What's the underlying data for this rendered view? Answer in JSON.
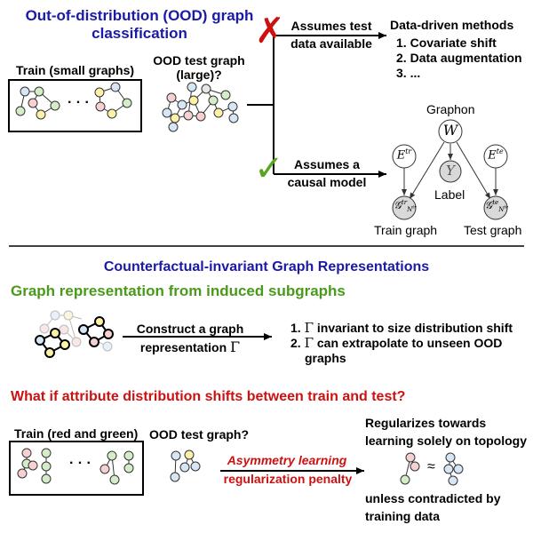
{
  "colors": {
    "title_blue": "#1a1aa6",
    "green": "#4a9a1a",
    "red": "#cc1111",
    "node_blue": "#d6e6f5",
    "node_green": "#d4edc8",
    "node_yellow": "#fdf1a8",
    "node_pink": "#f7d1d1",
    "node_gray": "#e6e6e6"
  },
  "section1": {
    "title_line1": "Out-of-distribution (OOD) graph",
    "title_line2": "classification",
    "train_label": "Train (small graphs)",
    "ellipsis": "· · ·",
    "ood_label_line1": "OOD test graph",
    "ood_label_line2": "(large)?",
    "branch_top_line1": "Assumes test",
    "branch_top_line2": "data available",
    "cross_icon": "✗",
    "check_icon": "✓",
    "data_driven_title": "Data-driven methods",
    "data_driven_items": [
      "Covariate shift",
      "Data augmentation",
      "..."
    ],
    "branch_bottom_line1": "Assumes a",
    "branch_bottom_line2": "causal model",
    "graphon_label": "Graphon",
    "node_W": "W",
    "node_Y": "Y",
    "node_Etr_base": "E",
    "node_Etr_sup": "tr",
    "node_Ete_base": "E",
    "node_Ete_sup": "te",
    "node_Gtr_base": "𝒢",
    "node_Gtr_sup": "tr",
    "node_Gtr_sub": "N",
    "node_Gtr_subsup": "tr",
    "node_Gte_base": "𝒢",
    "node_Gte_sup": "te",
    "node_Gte_sub": "N",
    "node_Gte_subsup": "te",
    "label_text": "Label",
    "train_graph_text": "Train graph",
    "test_graph_text": "Test graph"
  },
  "section2": {
    "title": "Counterfactual-invariant Graph Representations",
    "subtitle": "Graph representation from induced subgraphs",
    "arrow_line1": "Construct a graph",
    "arrow_line2": "representation",
    "gamma": "Γ",
    "list_items": [
      {
        "num": "1.",
        "text": "invariant to size distribution shift"
      },
      {
        "num": "2.",
        "text": "can extrapolate to unseen OOD"
      }
    ],
    "list_item2_cont": "graphs"
  },
  "section3": {
    "title": "What if attribute distribution shifts between train and test?",
    "train_label": "Train (red and green)",
    "ellipsis": "· · ·",
    "ood_label": "OOD test graph?",
    "arrow_line1": "Asymmetry learning",
    "arrow_line2": "regularization penalty",
    "result_line1": "Regularizes towards",
    "result_line2": "learning solely on topology",
    "approx": "≈",
    "unless_line1": "unless contradicted by",
    "unless_line2": "training data"
  }
}
